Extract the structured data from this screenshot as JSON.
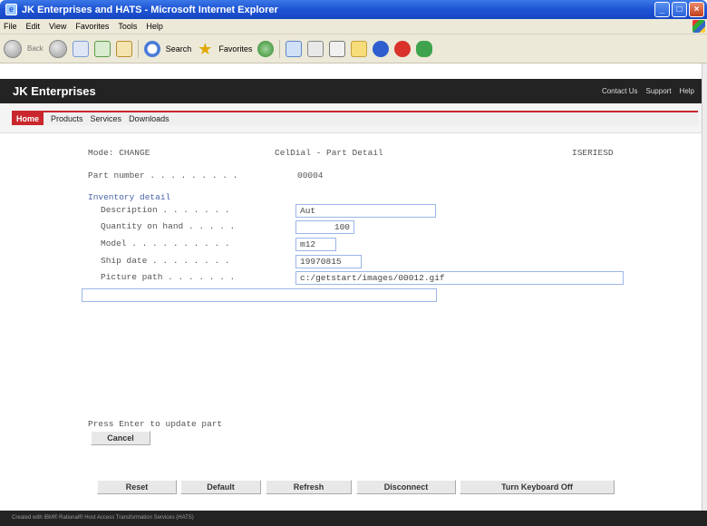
{
  "window": {
    "title": "JK Enterprises and HATS - Microsoft Internet Explorer",
    "min": "_",
    "max": "□",
    "close": "×"
  },
  "menu": [
    "File",
    "Edit",
    "View",
    "Favorites",
    "Tools",
    "Help"
  ],
  "toolbar": {
    "back": "Back",
    "search": "Search",
    "favorites": "Favorites"
  },
  "site": {
    "title": "JK Enterprises",
    "links": [
      "Contact Us",
      "Support",
      "Help"
    ]
  },
  "nav": {
    "home": "Home",
    "items": [
      "Products",
      "Services",
      "Downloads"
    ]
  },
  "screen": {
    "mode": "Mode: CHANGE",
    "heading": "CelDial - Part Detail",
    "system": "ISERIESD",
    "part_label": "Part number . . . . . . . . .",
    "part_value": "00004",
    "section": "Inventory detail",
    "fields": [
      {
        "label": "Description  . . . . . . .",
        "value": "Aut"
      },
      {
        "label": "Quantity on hand . . . . .",
        "value": "100"
      },
      {
        "label": "Model  . . . . . . . . . .",
        "value": "m12"
      },
      {
        "label": "Ship date  . . . . . . . .",
        "value": "19970815"
      },
      {
        "label": "Picture path . . . . . . .",
        "value": "c:/getstart/images/00012.gif"
      }
    ],
    "extra_value": "",
    "prompt": "Press Enter to update part",
    "cancel": "Cancel"
  },
  "buttons": [
    "Reset",
    "Default",
    "Refresh",
    "Disconnect",
    "Turn Keyboard Off"
  ],
  "footer": "Created with IBM® Rational® Host Access Transformation Services (HATS)"
}
